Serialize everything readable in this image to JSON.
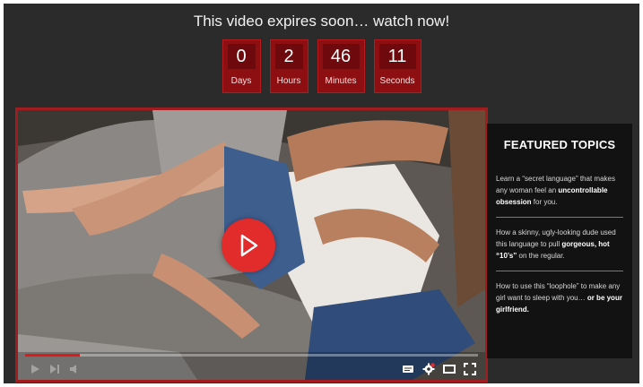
{
  "banner": {
    "headline": "This video expires soon… watch now!"
  },
  "countdown": [
    {
      "value": "0",
      "label": "Days"
    },
    {
      "value": "2",
      "label": "Hours"
    },
    {
      "value": "46",
      "label": "Minutes"
    },
    {
      "value": "11",
      "label": "Seconds"
    }
  ],
  "player": {
    "progress_fraction": 0.12,
    "accent_color": "#e22b2b",
    "icons": [
      "play-icon",
      "next-icon",
      "volume-icon",
      "captions-icon",
      "settings-icon",
      "theater-mode-icon",
      "fullscreen-icon"
    ]
  },
  "sidebar": {
    "title": "FEATURED TOPICS",
    "topics": [
      {
        "pre": "Learn a “secret language” that makes any woman feel an ",
        "bold": "uncontrollable obsession",
        "post": " for you."
      },
      {
        "pre": "How a skinny, ugly-looking dude used this language to pull ",
        "bold": "gorgeous, hot “10’s”",
        "post": " on the regular."
      },
      {
        "pre": "How to use this “loophole” to make any girl want to sleep with you… ",
        "bold": "or be your girlfriend.",
        "post": ""
      }
    ]
  }
}
